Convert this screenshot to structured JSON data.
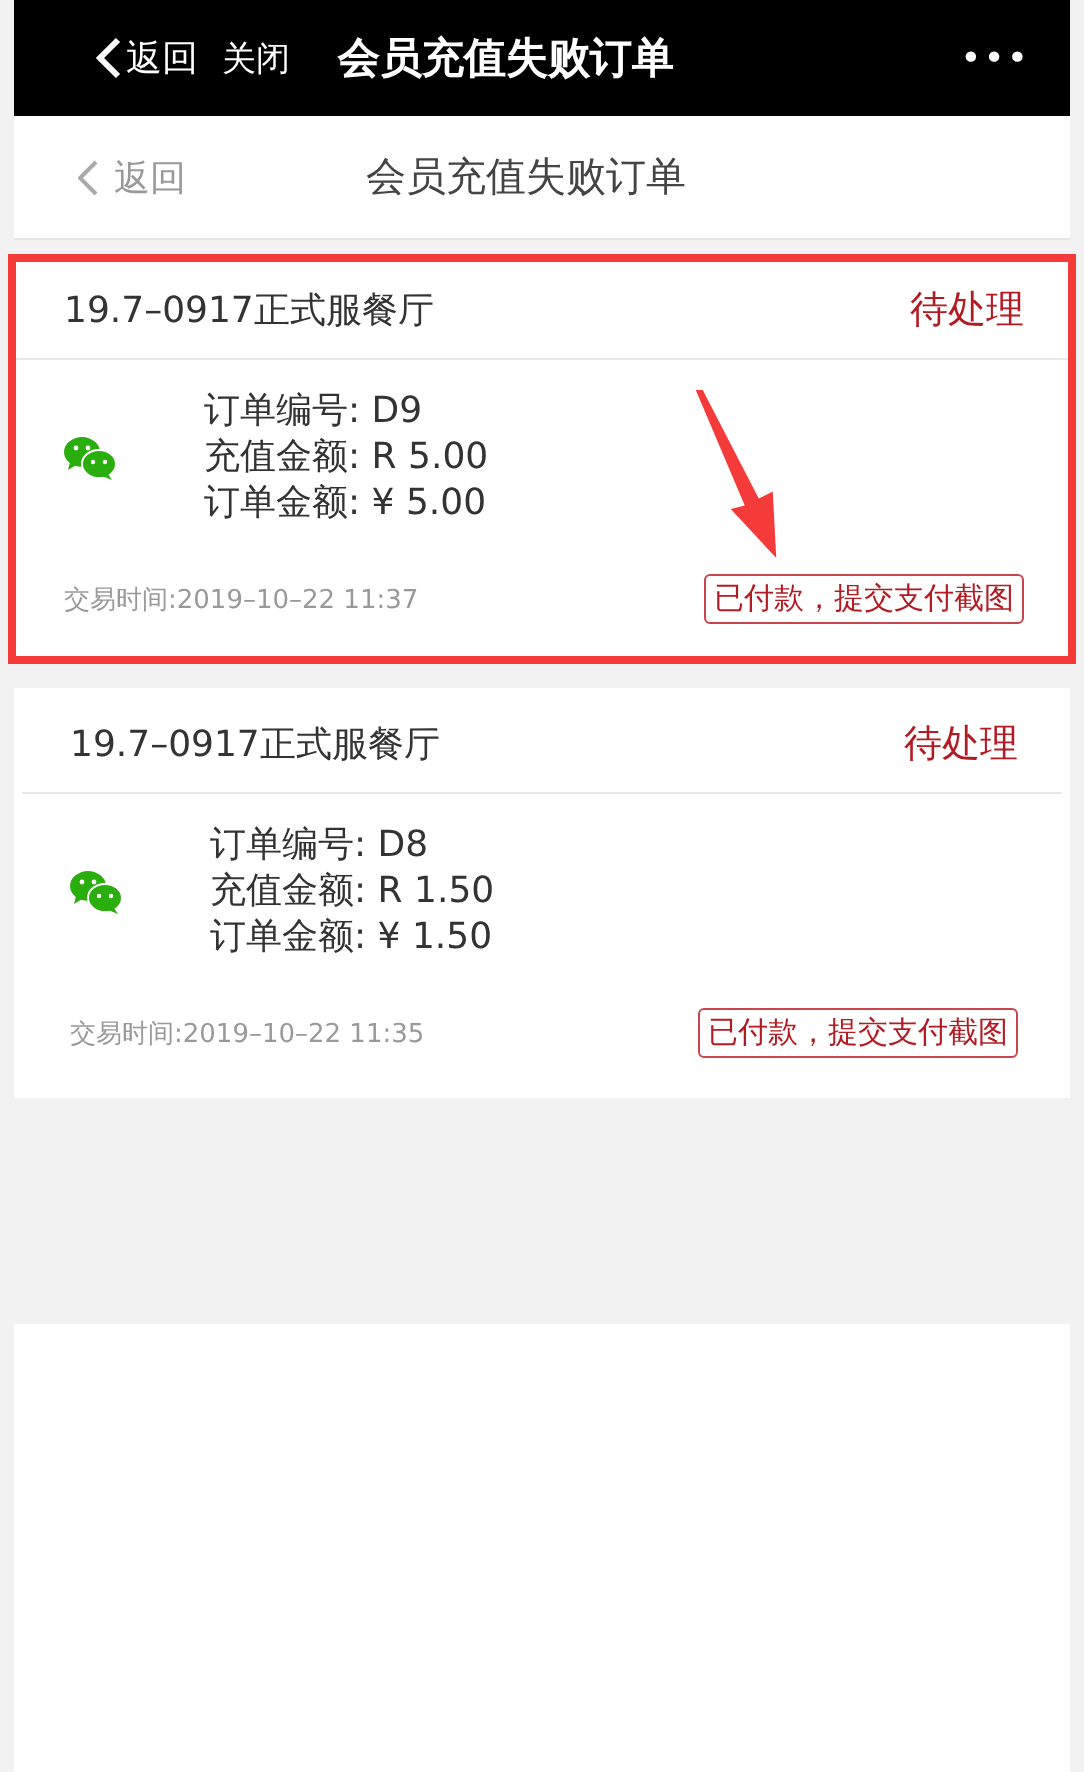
{
  "top_bar": {
    "back": "返回",
    "close": "关闭",
    "title": "会员充值失败订单",
    "more": "•••"
  },
  "nav_bar": {
    "back": "返回",
    "title": "会员充值失败订单"
  },
  "orders": [
    {
      "store": "19.7–0917正式服餐厅",
      "status": "待处理",
      "lines": [
        "订单编号: D9",
        "充值金额: R 5.00",
        "订单金额: ¥ 5.00"
      ],
      "time": "交易时间:2019–10–22 11:37",
      "action": "已付款，提交支付截图",
      "highlighted": true
    },
    {
      "store": "19.7–0917正式服餐厅",
      "status": "待处理",
      "lines": [
        "订单编号: D8",
        "充值金额: R 1.50",
        "订单金额: ¥ 1.50"
      ],
      "time": "交易时间:2019–10–22 11:35",
      "action": "已付款，提交支付截图",
      "highlighted": false
    }
  ]
}
